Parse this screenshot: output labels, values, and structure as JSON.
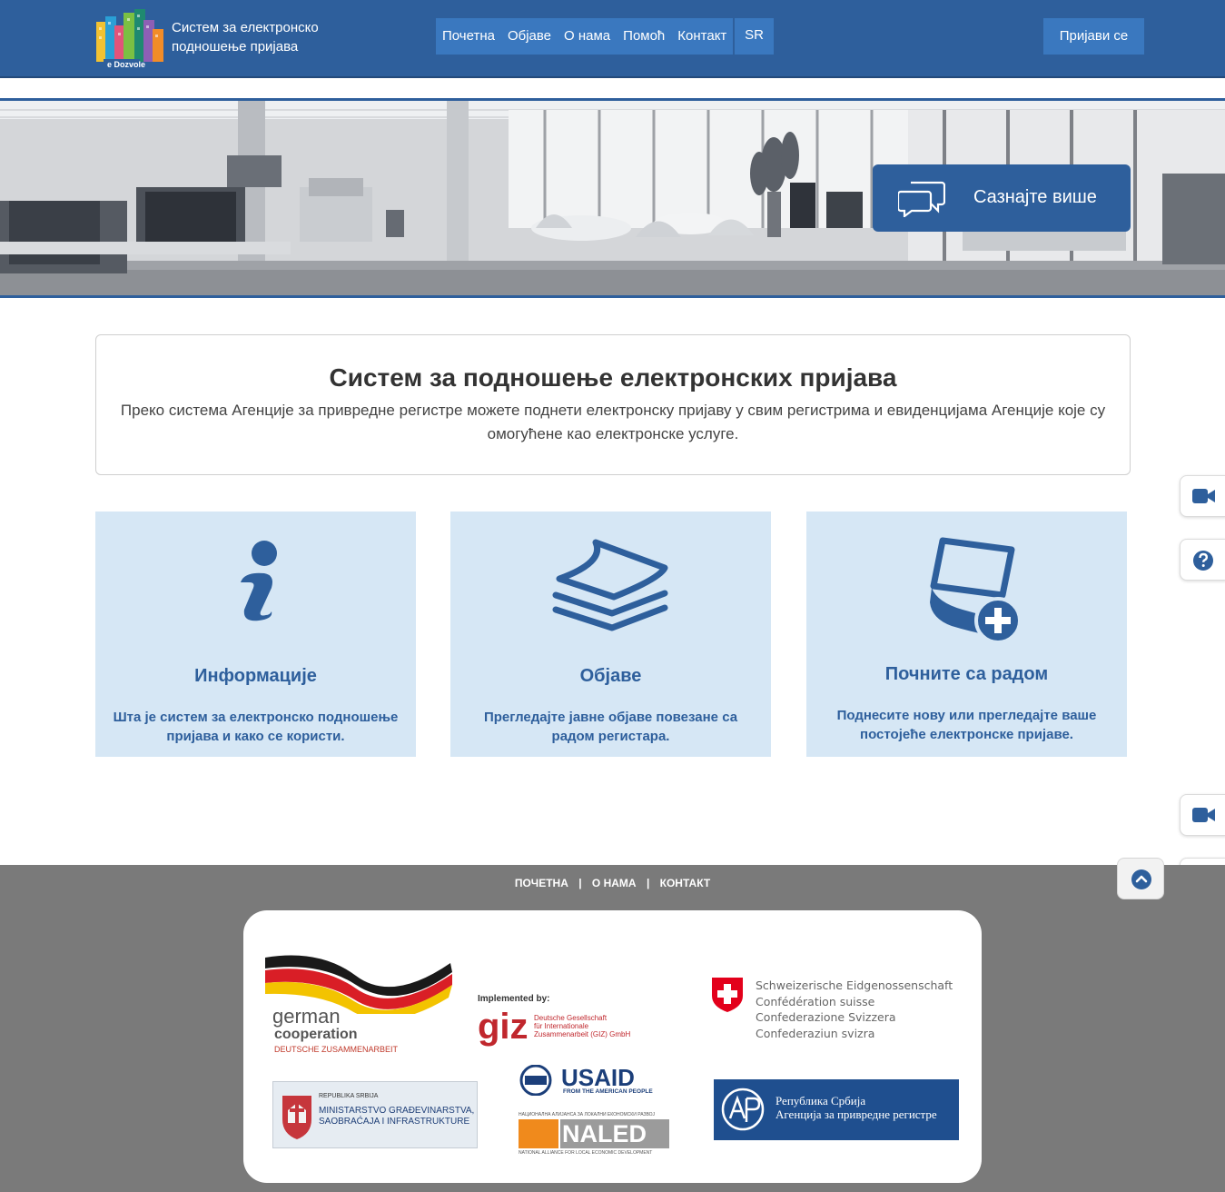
{
  "header": {
    "site_title": "Систем за електронско подношење пријава",
    "logo_text": "e Dozvole",
    "nav": [
      "Почетна",
      "Објаве",
      "О нама",
      "Помоћ",
      "Контакт"
    ],
    "lang": "SR",
    "login": "Пријави се"
  },
  "hero": {
    "learn_more": "Сазнајте више"
  },
  "intro": {
    "title": "Систем за подношење електронских пријава",
    "text": "Преко система Агенције за привредне регистре можете поднети електронску пријаву у свим регистрима и евиденцијама Агенције које су омогућене као електронске услуге."
  },
  "cards": [
    {
      "title": "Информације",
      "text": "Шта је систем за електронско подношење пријава и како се користи.",
      "icon": "info-icon"
    },
    {
      "title": "Објаве",
      "text": "Прегледајте јавне објаве повезане са радом регистара.",
      "icon": "layers-icon"
    },
    {
      "title": "Почните са радом",
      "text": "Поднесите нову или прегледајте ваше постојеће електронске пријаве.",
      "icon": "new-document-icon"
    }
  ],
  "footer": {
    "links": [
      "ПОЧЕТНА",
      "О НАМА",
      "КОНТАКТ"
    ],
    "separator": "|"
  },
  "partners": {
    "german": {
      "line1": "german",
      "line2": "cooperation",
      "line3": "DEUTSCHE ZUSAMMENARBEIT"
    },
    "giz": {
      "implemented": "Implemented by:",
      "logo": "giz",
      "desc1": "Deutsche Gesellschaft",
      "desc2": "für Internationale",
      "desc3": "Zusammenarbeit (GIZ) GmbH"
    },
    "swiss": [
      "Schweizerische Eidgenossenschaft",
      "Confédération suisse",
      "Confederazione Svizzera",
      "Confederaziun svizra"
    ],
    "ministry": {
      "line1": "REPUBLIKA SRBIJA",
      "line2": "MINISTARSTVO GRAĐEVINARSTVA,",
      "line3": "SAOBRAĆAJA I INFRASTRUKTURE"
    },
    "usaid": {
      "logo": "USAID",
      "tagline": "FROM THE AMERICAN PEOPLE"
    },
    "naled": {
      "top": "НАЦИОНАЛНА АЛИЈАНСА ЗА ЛОКАЛНИ ЕКОНОМСКИ РАЗВОЈ",
      "logo": "NALED",
      "bottom": "NATIONAL ALLIANCE FOR LOCAL ECONOMIC DEVELOPMENT"
    },
    "apr": {
      "line1": "Република Србија",
      "line2": "Агенција за привредне регистре"
    }
  },
  "colors": {
    "primary": "#2e5f9c",
    "nav": "#3a78bf",
    "card_bg": "#d6e7f5",
    "footer_bg": "#7a7a7a"
  }
}
